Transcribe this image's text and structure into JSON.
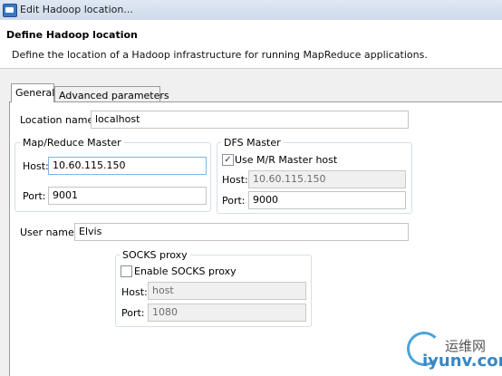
{
  "window": {
    "title": "Edit Hadoop location..."
  },
  "header": {
    "heading": "Define Hadoop location",
    "description": "Define the location of a Hadoop infrastructure for running MapReduce applications."
  },
  "tabs": [
    {
      "label": "General",
      "selected": true
    },
    {
      "label": "Advanced parameters",
      "selected": false
    }
  ],
  "general": {
    "location_name": {
      "label": "Location name:",
      "value": "localhost"
    },
    "mapreduce_master": {
      "title": "Map/Reduce Master",
      "host": {
        "label": "Host:",
        "value": "10.60.115.150"
      },
      "port": {
        "label": "Port:",
        "value": "9001"
      }
    },
    "dfs_master": {
      "title": "DFS Master",
      "use_mr_host": {
        "label": "Use M/R Master host",
        "checked": true,
        "mark": "✓"
      },
      "host": {
        "label": "Host:",
        "value": "10.60.115.150"
      },
      "port": {
        "label": "Port:",
        "value": "9000"
      }
    },
    "user_name": {
      "label": "User name:",
      "value": "Elvis"
    },
    "socks_proxy": {
      "title": "SOCKS proxy",
      "enable": {
        "label": "Enable SOCKS proxy",
        "checked": false
      },
      "host": {
        "label": "Host:",
        "value": "host"
      },
      "port": {
        "label": "Port:",
        "value": "1080"
      }
    }
  },
  "watermark": {
    "cn": "运维网",
    "url": "iyunv.com"
  },
  "colors": {
    "accent": "#7eb4ea",
    "titlebar": "#cfdbea",
    "watermark": "#3a86c4"
  }
}
